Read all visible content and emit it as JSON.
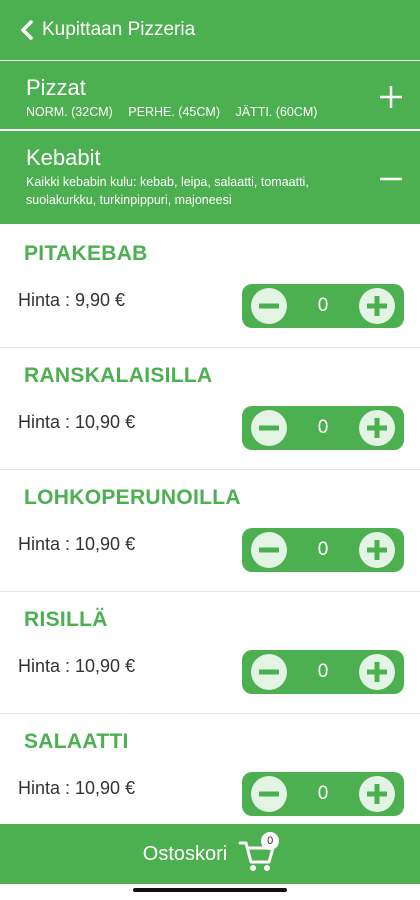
{
  "header": {
    "title": "Kupittaan Pizzeria"
  },
  "categories": {
    "pizzat": {
      "title": "Pizzat",
      "sizes": [
        "NORM. (32CM)",
        "PERHE. (45CM)",
        "JÄTTI. (60CM)"
      ],
      "toggle_icon": "plus-icon"
    },
    "kebabit": {
      "title": "Kebabit",
      "description": "Kaikki kebabin kulu: kebab, leipa, salaatti, tomaatti, suolakurkku, turkinpippuri, majoneesi",
      "toggle_icon": "minus-icon"
    }
  },
  "items": [
    {
      "name": "PITAKEBAB",
      "price": "Hinta : 9,90 €",
      "qty": "0"
    },
    {
      "name": "RANSKALAISILLA",
      "price": "Hinta : 10,90 €",
      "qty": "0"
    },
    {
      "name": "LOHKOPERUNOILLA",
      "price": "Hinta : 10,90 €",
      "qty": "0"
    },
    {
      "name": "RISILLÄ",
      "price": "Hinta : 10,90 €",
      "qty": "0"
    },
    {
      "name": "SALAATTI",
      "price": "Hinta : 10,90 €",
      "qty": "0"
    }
  ],
  "cart": {
    "label": "Ostoskori",
    "count": "0"
  },
  "colors": {
    "primary": "#4caf50",
    "icon_fill": "#e3f3e4"
  }
}
